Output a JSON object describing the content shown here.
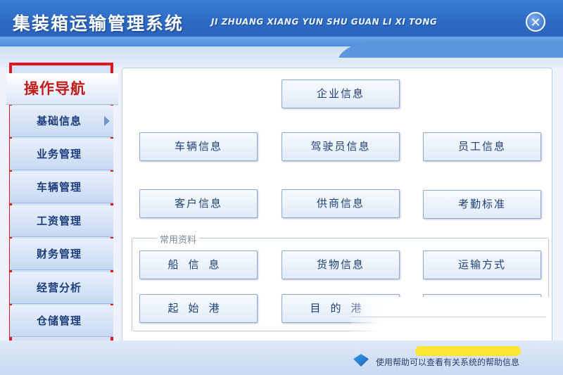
{
  "window": {
    "title_cn": "集装箱运输管理系统",
    "title_en": "JI ZHUANG XIANG YUN SHU GUAN LI XI TONG",
    "close_symbol": "✕"
  },
  "sidebar": {
    "header": "操作导航",
    "items": [
      {
        "label": "基础信息",
        "active": true
      },
      {
        "label": "业务管理"
      },
      {
        "label": "车辆管理"
      },
      {
        "label": "工资管理"
      },
      {
        "label": "财务管理"
      },
      {
        "label": "经营分析"
      },
      {
        "label": "仓储管理"
      }
    ]
  },
  "main": {
    "buttons": {
      "enterprise": "企业信息",
      "vehicle": "车辆信息",
      "driver": "驾驶员信息",
      "employee": "员工信息",
      "customer": "客户信息",
      "supplier": "供商信息",
      "attendance": "考勤标准"
    },
    "common_group": {
      "label": "常用资料",
      "buttons": {
        "ship": "船信息",
        "goods": "货物信息",
        "transport": "运输方式",
        "origin_port": "起始港",
        "destination": "目的港"
      }
    }
  },
  "footer": {
    "text": "使用帮助可以查看有关系统的帮助信息"
  },
  "colors": {
    "titlebar": "#2d6bc6",
    "highlight_frame": "#e0161c",
    "nav_header_text": "#c11b1b",
    "nav_text": "#1c3c7a",
    "button_text": "#1f3f77"
  }
}
